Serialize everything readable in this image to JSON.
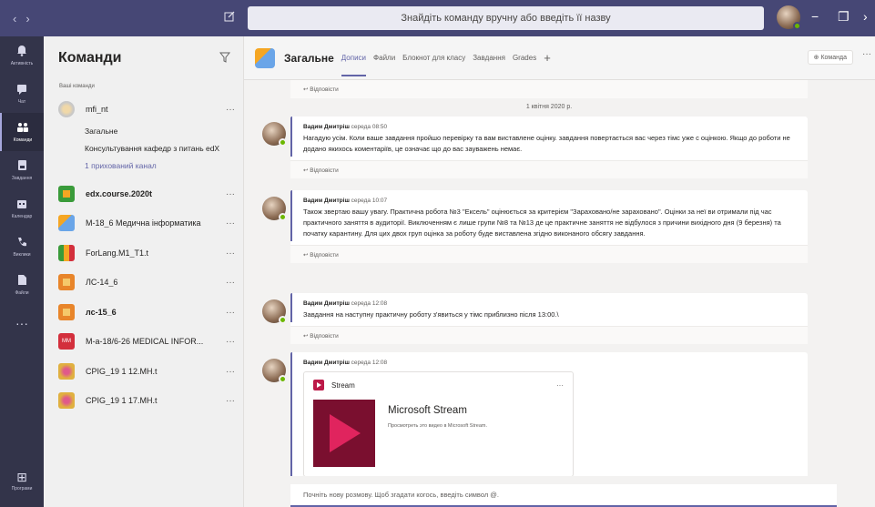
{
  "titlebar": {
    "back": "‹",
    "forward": "›",
    "search_placeholder": "Знайдіть команду вручну або введіть її назву",
    "minimize": "−",
    "maximize": "❐",
    "close": "›"
  },
  "rail": {
    "items": [
      {
        "label": "Активність",
        "icon": "bell-icon",
        "glyph": "🔔"
      },
      {
        "label": "Чат",
        "icon": "chat-icon",
        "glyph": "▤"
      },
      {
        "label": "Команди",
        "icon": "teams-icon",
        "glyph": "⁂"
      },
      {
        "label": "Завдання",
        "icon": "assignments-icon",
        "glyph": "▣"
      },
      {
        "label": "Календар",
        "icon": "calendar-icon",
        "glyph": "▦"
      },
      {
        "label": "Виклики",
        "icon": "phone-icon",
        "glyph": "✆"
      },
      {
        "label": "Файли",
        "icon": "file-icon",
        "glyph": "▮"
      },
      {
        "label": "",
        "icon": "more-apps-icon",
        "glyph": "···"
      }
    ],
    "apps_label": "Програми",
    "apps_glyph": "⊞"
  },
  "teams_panel": {
    "title": "Команди",
    "subtitle": "Ваші команди",
    "teams": [
      {
        "name": "mfi_nt",
        "bold": false,
        "color": "#e8e8e8"
      },
      {
        "name": "edx.course.2020t",
        "bold": true,
        "color": "#3a9b3a"
      },
      {
        "name": "М-18_6 Медична інформатика",
        "bold": false,
        "color": "#6aa5e8"
      },
      {
        "name": "ForLang.M1_T1.t",
        "bold": false,
        "color": "#e05a2a"
      },
      {
        "name": "ЛС-14_6",
        "bold": false,
        "color": "#e8852a"
      },
      {
        "name": "лс-15_6",
        "bold": true,
        "color": "#e8852a"
      },
      {
        "name": "М-а-18/6-26 MEDICAL INFOR...",
        "bold": false,
        "color": "#d32f3c"
      },
      {
        "name": "CPIG_19 1 12.MH.t",
        "bold": false,
        "color": "#e0b040"
      },
      {
        "name": "CPIG_19 1 17.MH.t",
        "bold": false,
        "color": "#e0b040"
      }
    ],
    "mm_label": "MM",
    "channels": [
      "Загальне",
      "Консультування кафедр з питань edX"
    ],
    "hidden_channels": "1 прихований канал",
    "more": "···"
  },
  "channel_header": {
    "name": "Загальне",
    "tabs": [
      "Дописи",
      "Файли",
      "Блокнот для класу",
      "Завдання",
      "Grades"
    ],
    "add_tab": "+",
    "team_button": "⊕ Команда",
    "more": "···"
  },
  "feed": {
    "top_reply": "↩ Відповісти",
    "date_separator": "1 квітня 2020 р.",
    "posts": [
      {
        "author": "Вадим Дмитріш",
        "time": "середа 08:50",
        "text": "Нагадую усім. Коли ваше завдання пройшо перевірку та вам виставлене оцінку. завдання повертається вас через тімс уже с оцінкою. Якщо до роботи не додано якихось коментаріїв, це означає що до вас зауважень немає.",
        "reply": "↩ Відповісти"
      },
      {
        "author": "Вадим Дмитріш",
        "time": "середа 10:07",
        "text": "Також звертаю вашу увагу. Практична робота №3 \"Ексель\" оцінюється за критерієм \"Зараховано/не зараховано\". Оцінки за неї ви отримали під час практичного заняття в аудиторії. Виключенням є лише групи №8 та №13 де це практичне заняття не відбулося з причини вихідного дня (9 березня) та початку карантину. Для цих двох груп оцінка за роботу буде виставлена згідно виконаного обсягу завдання.",
        "reply": "↩ Відповісти"
      },
      {
        "author": "Вадим Дмитріш",
        "time": "середа 12:08",
        "text": "Завдання на наступну практичну роботу з'явиться у тімс приблизно після 13:00.\\",
        "reply": "↩ Відповісти"
      },
      {
        "author": "Вадим Дмитріш",
        "time": "середа 12:08",
        "card": {
          "source": "Stream",
          "title": "Microsoft Stream",
          "description": "Просмотреть это видео в Microsoft Stream.",
          "more": "···"
        }
      }
    ]
  },
  "compose": {
    "placeholder": "Почніть нову розмову. Щоб згадати когось, введіть символ @."
  }
}
